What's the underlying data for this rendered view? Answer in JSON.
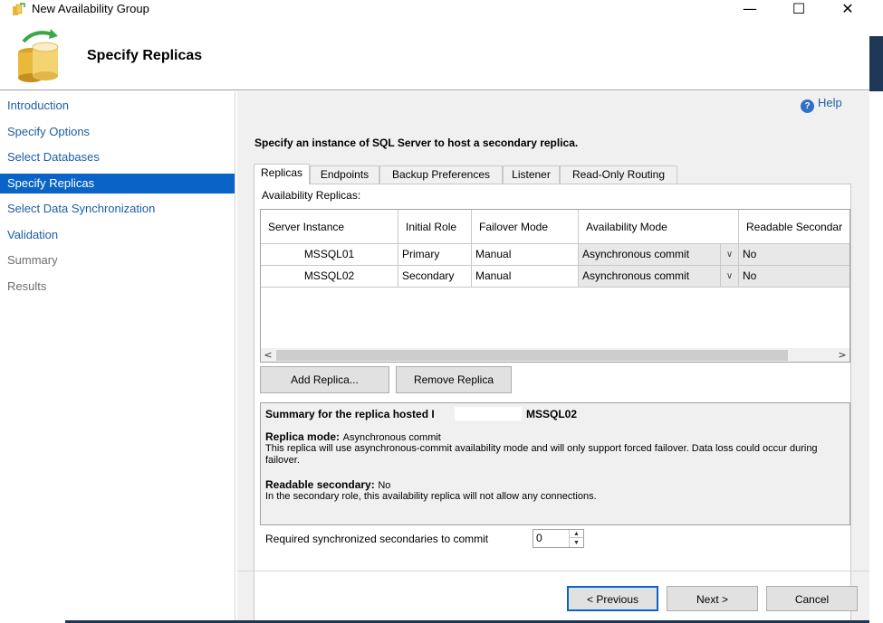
{
  "window": {
    "title": "New Availability Group",
    "minimize_glyph": "—",
    "maximize_glyph": "☐",
    "close_glyph": "✕"
  },
  "header": {
    "heading": "Specify Replicas",
    "icon": "availability-group-icon"
  },
  "nav": {
    "items": [
      {
        "label": "Introduction",
        "state": "normal"
      },
      {
        "label": "Specify Options",
        "state": "normal"
      },
      {
        "label": "Select Databases",
        "state": "normal"
      },
      {
        "label": "Specify Replicas",
        "state": "active"
      },
      {
        "label": "Select Data Synchronization",
        "state": "normal"
      },
      {
        "label": "Validation",
        "state": "normal"
      },
      {
        "label": "Summary",
        "state": "disabled"
      },
      {
        "label": "Results",
        "state": "disabled"
      }
    ]
  },
  "help": {
    "label": "Help",
    "icon_glyph": "?"
  },
  "instruction": "Specify an instance of SQL Server to host a secondary replica.",
  "tabs": [
    {
      "label": "Replicas",
      "active": true
    },
    {
      "label": "Endpoints",
      "active": false
    },
    {
      "label": "Backup Preferences",
      "active": false
    },
    {
      "label": "Listener",
      "active": false
    },
    {
      "label": "Read-Only Routing",
      "active": false
    }
  ],
  "replicas": {
    "label": "Availability Replicas:",
    "columns": [
      "Server Instance",
      "Initial Role",
      "Failover Mode",
      "Availability Mode",
      "Readable Secondar"
    ],
    "rows": [
      {
        "server": "MSSQL01",
        "role": "Primary",
        "failover": "Manual",
        "availability": "Asynchronous commit",
        "readable": "No"
      },
      {
        "server": "MSSQL02",
        "role": "Secondary",
        "failover": "Manual",
        "availability": "Asynchronous commit",
        "readable": "No"
      }
    ],
    "combo_arrow": "∨",
    "scroll_left": "<",
    "scroll_right": ">"
  },
  "buttons": {
    "add_replica": "Add Replica...",
    "remove_replica": "Remove Replica",
    "previous": "< Previous",
    "next": "Next >",
    "cancel": "Cancel"
  },
  "summary": {
    "title_prefix": "Summary for the replica hosted I",
    "title_host": "MSSQL02",
    "replica_mode_label": "Replica mode:",
    "replica_mode_value": "Asynchronous commit",
    "replica_mode_desc": "This replica will use asynchronous-commit availability mode and will only support forced failover. Data loss could occur during failover.",
    "readable_label": "Readable secondary:",
    "readable_value": "No",
    "readable_desc": "In the secondary role, this availability replica will not allow any connections."
  },
  "sync": {
    "label": "Required synchronized secondaries to commit",
    "value": "0",
    "up": "▲",
    "down": "▼"
  }
}
